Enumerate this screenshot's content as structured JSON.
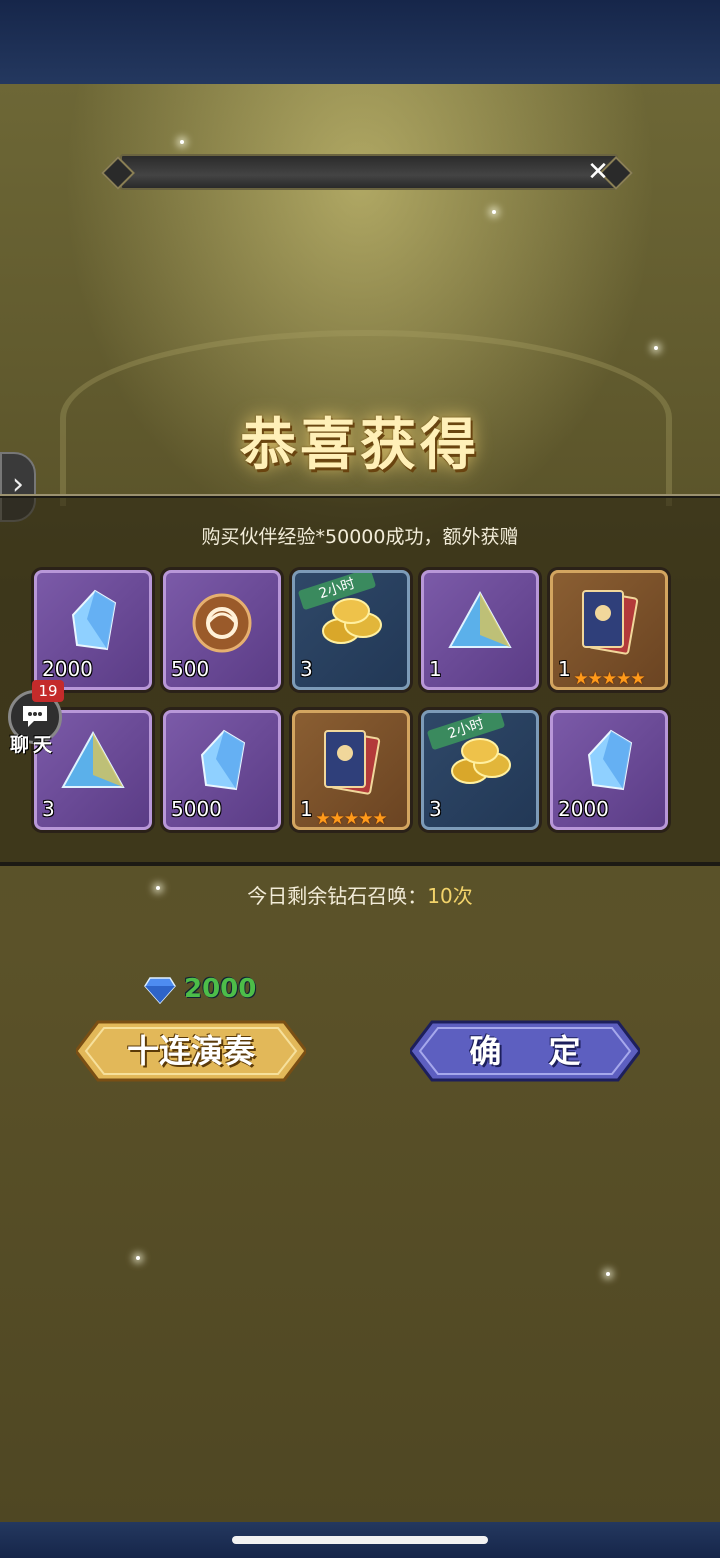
{
  "dialog": {
    "title": "恭喜获得",
    "subtitle": "购买伙伴经验*50000成功，额外获赠",
    "close_icon": "close-icon"
  },
  "rewards": [
    {
      "icon": "blue-crystal-icon",
      "quantity": "2000",
      "frame": "purple"
    },
    {
      "icon": "bronze-medallion-icon",
      "quantity": "500",
      "frame": "purple"
    },
    {
      "icon": "gold-coins-icon",
      "quantity": "3",
      "frame": "blue",
      "tag": "2小时"
    },
    {
      "icon": "triangle-gem-icon",
      "quantity": "1",
      "frame": "purple"
    },
    {
      "icon": "hero-card-icon",
      "quantity": "1",
      "frame": "brown",
      "stars": "★★★★★"
    },
    {
      "icon": "triangle-gem-icon",
      "quantity": "3",
      "frame": "purple"
    },
    {
      "icon": "blue-crystal-icon",
      "quantity": "5000",
      "frame": "purple"
    },
    {
      "icon": "hero-card-icon",
      "quantity": "1",
      "frame": "brown",
      "stars": "★★★★★"
    },
    {
      "icon": "gold-coins-icon",
      "quantity": "3",
      "frame": "blue",
      "tag": "2小时"
    },
    {
      "icon": "blue-crystal-icon",
      "quantity": "2000",
      "frame": "purple"
    }
  ],
  "summon": {
    "remaining_label": "今日剩余钻石召唤：",
    "remaining_count": "10次",
    "cost": "2000",
    "cost_icon": "diamond-icon"
  },
  "buttons": {
    "ten_pull": "十连演奏",
    "confirm": "确 定"
  },
  "chat": {
    "badge": "19",
    "label": "聊天",
    "icon": "chat-bubble-icon"
  },
  "side_arrow": "›",
  "colors": {
    "cost_green": "#4dbd49",
    "count_gold": "#f2d36a",
    "gold_button": "#e2b859",
    "blue_button": "#5d5fc0"
  }
}
